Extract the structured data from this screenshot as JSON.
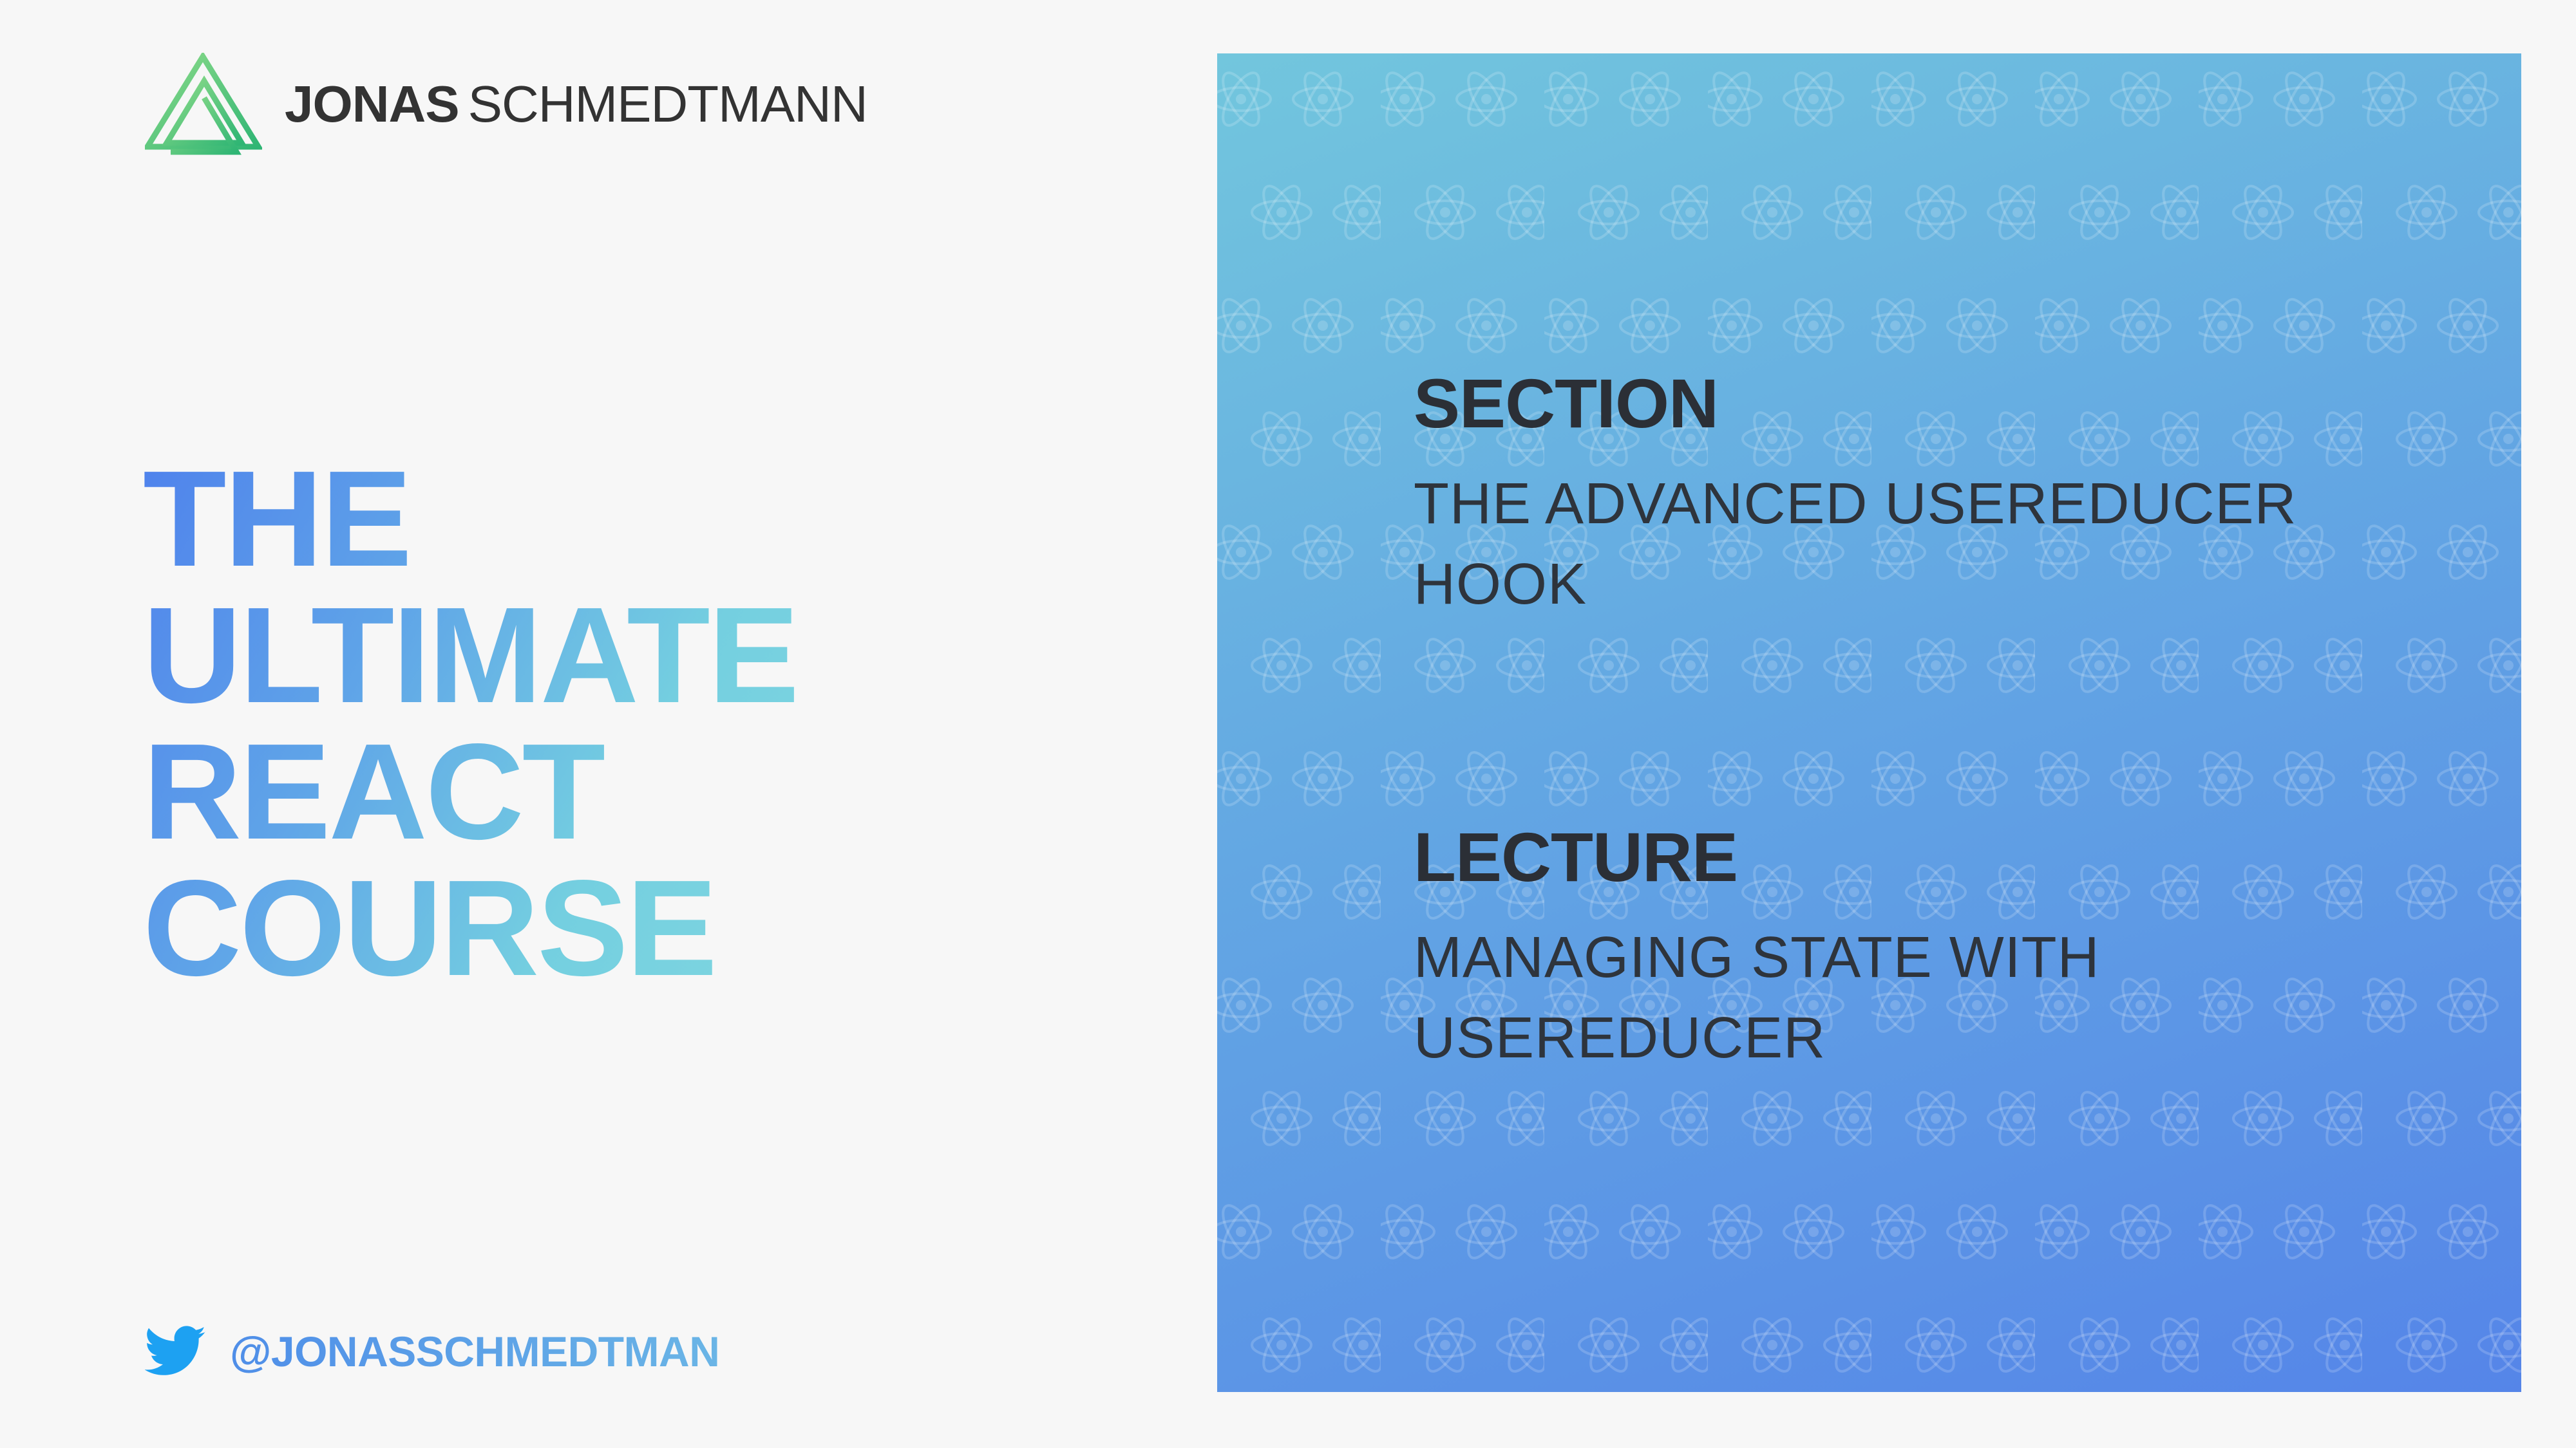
{
  "brand": {
    "first_name": "JONAS",
    "last_name": "SCHMEDTMANN",
    "logo_icon": "triangle-logo-icon"
  },
  "course": {
    "title_lines": [
      "THE",
      "ULTIMATE",
      "REACT",
      "COURSE"
    ]
  },
  "social": {
    "icon": "twitter-icon",
    "handle": "@JONASSCHMEDTMAN"
  },
  "card": {
    "pattern_icon": "react-atom-icon",
    "section": {
      "heading": "SECTION",
      "lines": [
        "THE ADVANCED USEREDUCER",
        "HOOK"
      ]
    },
    "lecture": {
      "heading": "LECTURE",
      "lines": [
        "MANAGING STATE WITH",
        "USEREDUCER"
      ]
    }
  },
  "colors": {
    "page_background": "#f7f7f7",
    "title_gradient_start": "#4f82ec",
    "title_gradient_end": "#7fd6df",
    "logo_green_light": "#7fd78a",
    "logo_green_dark": "#2fb574",
    "card_gradient_start": "#72c6dd",
    "card_gradient_end": "#5585e8",
    "twitter_blue": "#1da1f2",
    "heading_text": "#2b2f36"
  }
}
